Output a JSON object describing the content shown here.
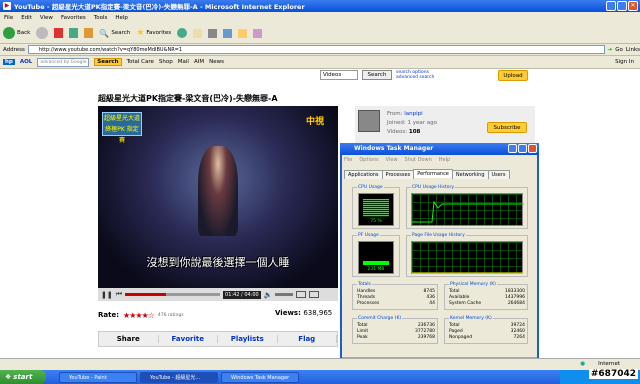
{
  "window": {
    "title": "YouTube - 超級星光大道PK指定賽-梁文音(巴冷)-失戀無罪-A - Microsoft Internet Explorer"
  },
  "menu": [
    "File",
    "Edit",
    "View",
    "Favorites",
    "Tools",
    "Help"
  ],
  "toolbar": {
    "back": "Back",
    "search": "Search",
    "favorites": "Favorites"
  },
  "address": {
    "label": "Address",
    "url": "http://www.youtube.com/watch?v=qY80meMdIBU&NR=1",
    "go": "Go",
    "links": "Links"
  },
  "linksbar": {
    "aol": "AOL",
    "search_placeholder": "advanced by Google",
    "search_btn": "Search",
    "items": [
      "Total Care",
      "Shop",
      "Mail",
      "AIM",
      "News"
    ],
    "signin": "Sign In"
  },
  "youtube": {
    "filter": "Videos",
    "search_btn": "Search",
    "adv1": "search options",
    "adv2": "advanced search",
    "upload": "Upload",
    "video_title": "超級星光大道PK指定賽-梁文音(巴冷)-失戀無罪-A",
    "logo_text": "超級星光大道 終極PK 指定賽",
    "tv_logo": "中視",
    "subtitle": "沒想到你說最後選擇一個人睡",
    "time": "01:42 / 04:00",
    "progress": 0.43,
    "rate_label": "Rate:",
    "ratings": "476 ratings",
    "views_label": "Views:",
    "views": "638,965",
    "share": [
      "Share",
      "Favorite",
      "Playlists",
      "Flag"
    ],
    "user": {
      "from_label": "From:",
      "from": "lanpipi",
      "joined_label": "Joined:",
      "joined": "1 year ago",
      "videos_label": "Videos:",
      "videos": "108",
      "subscribe": "Subscribe"
    }
  },
  "taskmanager": {
    "title": "Windows Task Manager",
    "menu": [
      "File",
      "Options",
      "View",
      "Shut Down",
      "Help"
    ],
    "tabs": [
      "Applications",
      "Processes",
      "Performance",
      "Networking",
      "Users"
    ],
    "active_tab": "Performance",
    "cpu_usage_label": "CPU Usage",
    "cpu_usage": "75 %",
    "cpu_history_label": "CPU Usage History",
    "pf_label": "PF Usage",
    "pf": "231 MB",
    "pf_history_label": "Page File Usage History",
    "totals": {
      "label": "Totals",
      "rows": [
        [
          "Handles",
          "8745"
        ],
        [
          "Threads",
          "436"
        ],
        [
          "Processes",
          "44"
        ]
      ]
    },
    "physical": {
      "label": "Physical Memory (K)",
      "rows": [
        [
          "Total",
          "1833300"
        ],
        [
          "Available",
          "1437996"
        ],
        [
          "System Cache",
          "264684"
        ]
      ]
    },
    "commit": {
      "label": "Commit Charge (K)",
      "rows": [
        [
          "Total",
          "236736"
        ],
        [
          "Limit",
          "3772780"
        ],
        [
          "Peak",
          "239768"
        ]
      ]
    },
    "kernel": {
      "label": "Kernel Memory (K)",
      "rows": [
        [
          "Total",
          "39724"
        ],
        [
          "Paged",
          "32460"
        ],
        [
          "Nonpaged",
          "7264"
        ]
      ]
    },
    "status": {
      "processes": "Processes: 44",
      "cpu": "CPU Usage: 75%",
      "commit": "Commit Charge: 231M / 3684M"
    }
  },
  "iestatus": {
    "zone": "Internet"
  },
  "taskbar": {
    "start": "start",
    "items": [
      "YouTube - Paint",
      "YouTube - 超級星光...",
      "Windows Task Manager"
    ],
    "active": 1
  },
  "watermark": "#687042",
  "colors": {
    "xp_blue": "#0a50d8",
    "yt_red": "#cc0000",
    "graph_green": "#00ff00"
  }
}
